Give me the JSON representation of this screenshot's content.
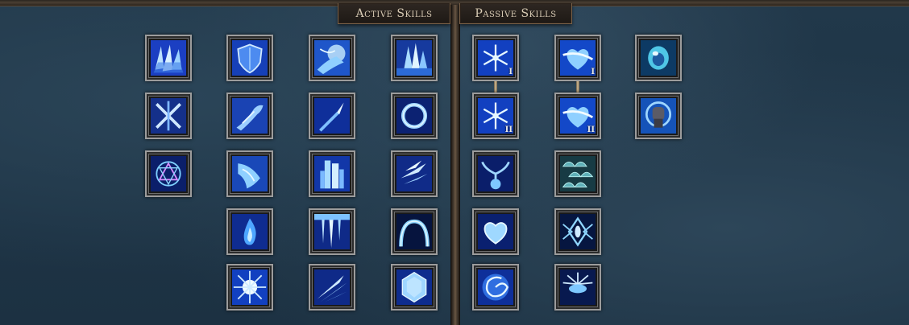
{
  "tabs": {
    "active_label": "Active Skills",
    "passive_label": "Passive Skills"
  },
  "active_skills": [
    {
      "name": "ice-shards-icon"
    },
    {
      "name": "ice-shield-icon"
    },
    {
      "name": "frost-hand-icon"
    },
    {
      "name": "ice-crystals-icon"
    },
    {
      "name": "crossed-swords-frost-icon"
    },
    {
      "name": "frost-arm-icon"
    },
    {
      "name": "ice-spear-icon"
    },
    {
      "name": "frost-ring-icon"
    },
    {
      "name": "rune-circle-icon"
    },
    {
      "name": "frost-claw-icon"
    },
    {
      "name": "ice-pillar-icon"
    },
    {
      "name": "ice-shard-burst-icon"
    },
    {
      "name": "frost-flame-icon"
    },
    {
      "name": "icicle-fall-icon"
    },
    {
      "name": "frost-arch-icon"
    },
    {
      "name": "frost-nova-icon"
    },
    {
      "name": "ice-wind-icon"
    },
    {
      "name": "ice-crystal-block-icon"
    }
  ],
  "passive_skills": [
    {
      "name": "snowflake-icon",
      "rank": "I"
    },
    {
      "name": "frost-heart-slash-icon",
      "rank": "I"
    },
    {
      "name": "frost-orb-icon",
      "rank": ""
    },
    {
      "name": "snowflake-icon",
      "rank": "II"
    },
    {
      "name": "frost-heart-slash-icon",
      "rank": "II"
    },
    {
      "name": "frost-fist-icon",
      "rank": ""
    },
    {
      "name": "frost-tree-icon",
      "rank": ""
    },
    {
      "name": "dragon-scales-icon",
      "rank": ""
    },
    {
      "name": "ice-heart-icon",
      "rank": ""
    },
    {
      "name": "frost-emblem-icon",
      "rank": ""
    },
    {
      "name": "frost-vortex-icon",
      "rank": ""
    },
    {
      "name": "frost-sunburst-icon",
      "rank": ""
    }
  ],
  "colors": {
    "accent": "#2a6ee8",
    "frame": "#9c9c9c",
    "tab_border": "#7a6148",
    "tab_text": "#d8cbb4"
  }
}
